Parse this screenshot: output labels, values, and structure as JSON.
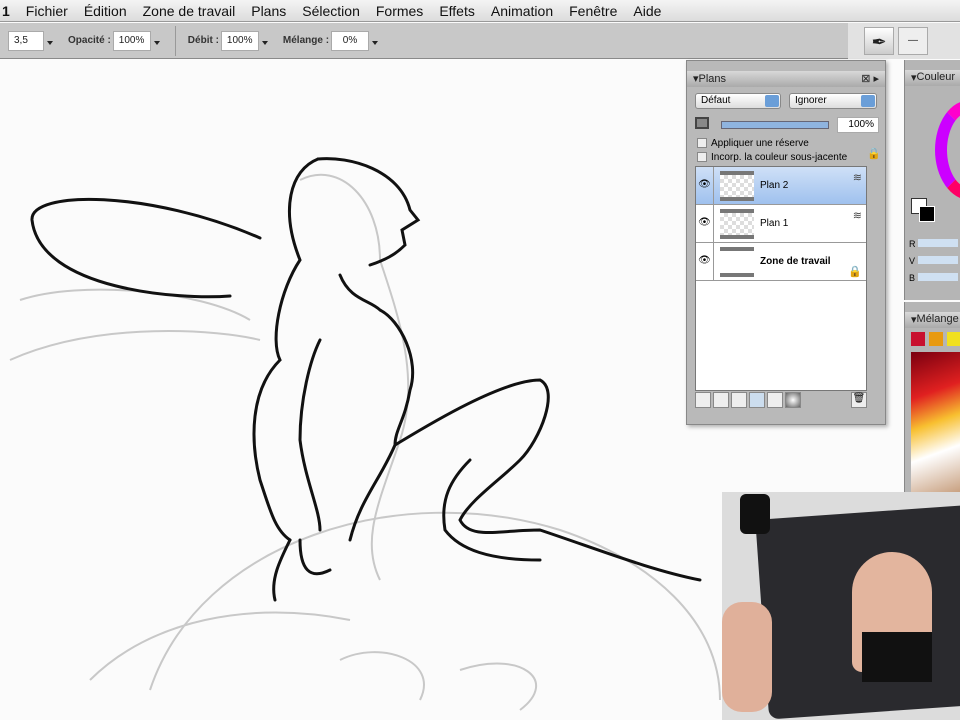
{
  "menubar": {
    "items": [
      "1",
      "Fichier",
      "Édition",
      "Zone de travail",
      "Plans",
      "Sélection",
      "Formes",
      "Effets",
      "Animation",
      "Fenêtre",
      "Aide"
    ]
  },
  "toolbar": {
    "size": "3,5",
    "opacity_label": "Opacité :",
    "opacity": "100%",
    "flow_label": "Débit :",
    "flow": "100%",
    "mix_label": "Mélange :",
    "mix": "0%"
  },
  "layers_panel": {
    "title": "Plans",
    "composite": "Défaut",
    "depth": "Ignorer",
    "opacity": "100%",
    "opacity_value": 100,
    "check1": "Appliquer une réserve",
    "check2": "Incorp. la couleur sous-jacente",
    "layers": [
      {
        "name": "Plan 2",
        "active": true
      },
      {
        "name": "Plan 1",
        "active": false
      },
      {
        "name": "Zone de travail",
        "active": false
      }
    ]
  },
  "color_panel": {
    "title": "Couleur",
    "channels": [
      "R",
      "V",
      "B"
    ]
  },
  "mix_panel": {
    "title": "Mélange",
    "swatches": [
      "#c8102e",
      "#e89a10",
      "#f0e020"
    ]
  }
}
